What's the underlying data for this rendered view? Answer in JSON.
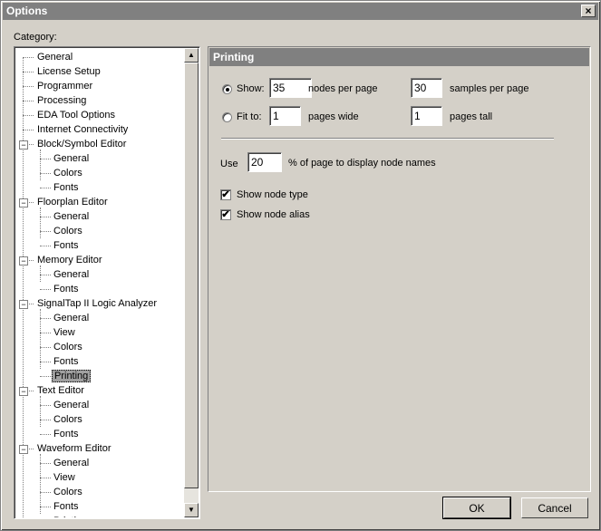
{
  "window": {
    "title": "Options",
    "close_glyph": "×"
  },
  "category_label": "Category:",
  "tree": [
    {
      "label": "General",
      "level": 0
    },
    {
      "label": "License Setup",
      "level": 0
    },
    {
      "label": "Programmer",
      "level": 0
    },
    {
      "label": "Processing",
      "level": 0
    },
    {
      "label": "EDA Tool Options",
      "level": 0
    },
    {
      "label": "Internet Connectivity",
      "level": 0
    },
    {
      "label": "Block/Symbol Editor",
      "level": 0,
      "expander": "−"
    },
    {
      "label": "General",
      "level": 1
    },
    {
      "label": "Colors",
      "level": 1
    },
    {
      "label": "Fonts",
      "level": 1
    },
    {
      "label": "Floorplan Editor",
      "level": 0,
      "expander": "−"
    },
    {
      "label": "General",
      "level": 1
    },
    {
      "label": "Colors",
      "level": 1
    },
    {
      "label": "Fonts",
      "level": 1
    },
    {
      "label": "Memory Editor",
      "level": 0,
      "expander": "−"
    },
    {
      "label": "General",
      "level": 1
    },
    {
      "label": "Fonts",
      "level": 1
    },
    {
      "label": "SignalTap II Logic Analyzer",
      "level": 0,
      "expander": "−"
    },
    {
      "label": "General",
      "level": 1
    },
    {
      "label": "View",
      "level": 1
    },
    {
      "label": "Colors",
      "level": 1
    },
    {
      "label": "Fonts",
      "level": 1
    },
    {
      "label": "Printing",
      "level": 1,
      "selected": true
    },
    {
      "label": "Text Editor",
      "level": 0,
      "expander": "−"
    },
    {
      "label": "General",
      "level": 1
    },
    {
      "label": "Colors",
      "level": 1
    },
    {
      "label": "Fonts",
      "level": 1
    },
    {
      "label": "Waveform Editor",
      "level": 0,
      "expander": "−"
    },
    {
      "label": "General",
      "level": 1
    },
    {
      "label": "View",
      "level": 1
    },
    {
      "label": "Colors",
      "level": 1
    },
    {
      "label": "Fonts",
      "level": 1
    },
    {
      "label": "Printing",
      "level": 1
    }
  ],
  "scrollbar": {
    "up_glyph": "▲",
    "down_glyph": "▼"
  },
  "panel": {
    "header": "Printing",
    "show": {
      "label": "Show:",
      "checked": true,
      "nodes_value": "35",
      "nodes_label": "nodes per page",
      "samples_value": "30",
      "samples_label": "samples per page"
    },
    "fit": {
      "label": "Fit to:",
      "checked": false,
      "wide_value": "1",
      "wide_label": "pages wide",
      "tall_value": "1",
      "tall_label": "pages tall"
    },
    "use": {
      "label": "Use",
      "value": "20",
      "suffix": "% of page to display node names"
    },
    "show_type": {
      "label": "Show node type",
      "checked": true
    },
    "show_alias": {
      "label": "Show node alias",
      "checked": true
    },
    "check_glyph": "✔"
  },
  "buttons": {
    "ok": "OK",
    "cancel": "Cancel"
  }
}
